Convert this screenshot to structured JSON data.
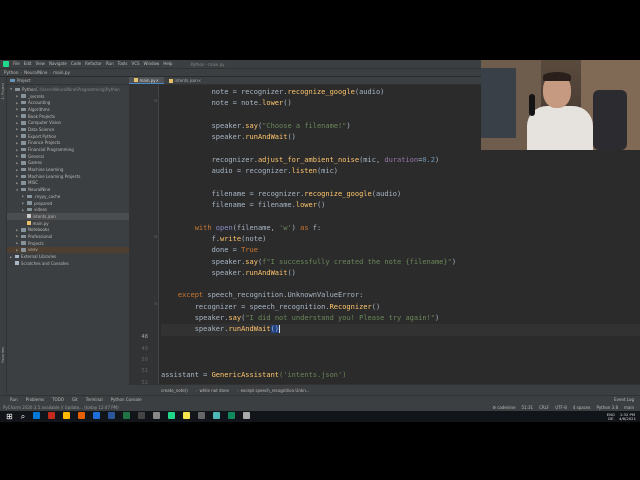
{
  "menubar": {
    "items": [
      "File",
      "Edit",
      "View",
      "Navigate",
      "Code",
      "Refactor",
      "Run",
      "Tools",
      "VCS",
      "Window",
      "Help"
    ],
    "title": "Python - main.py"
  },
  "navbar": {
    "crumbs": [
      "Python",
      "NeuralNine",
      "main.py"
    ]
  },
  "left_strip": {
    "top": "1: Project",
    "bottom": "Favorites"
  },
  "project": {
    "title": "Project",
    "tree": [
      {
        "label": "Python",
        "suffix": " C:\\Users\\NeuralNine\\Programming\\Python",
        "indent": 0,
        "kind": "folder",
        "open": true,
        "state": ""
      },
      {
        "label": "_secrets",
        "indent": 1,
        "kind": "folder",
        "open": false,
        "state": ""
      },
      {
        "label": "Accounting",
        "indent": 1,
        "kind": "folder",
        "open": false,
        "state": ""
      },
      {
        "label": "Algorithms",
        "indent": 1,
        "kind": "folder",
        "open": false,
        "state": ""
      },
      {
        "label": "Book Projects",
        "indent": 1,
        "kind": "folder",
        "open": false,
        "state": ""
      },
      {
        "label": "Computer Vision",
        "indent": 1,
        "kind": "folder",
        "open": false,
        "state": ""
      },
      {
        "label": "Data Science",
        "indent": 1,
        "kind": "folder",
        "open": false,
        "state": ""
      },
      {
        "label": "Export Python",
        "indent": 1,
        "kind": "folder",
        "open": false,
        "state": ""
      },
      {
        "label": "Finance Projects",
        "indent": 1,
        "kind": "folder",
        "open": false,
        "state": ""
      },
      {
        "label": "Financial Programming",
        "indent": 1,
        "kind": "folder",
        "open": false,
        "state": ""
      },
      {
        "label": "General",
        "indent": 1,
        "kind": "folder",
        "open": false,
        "state": ""
      },
      {
        "label": "Games",
        "indent": 1,
        "kind": "folder",
        "open": false,
        "state": ""
      },
      {
        "label": "Machine Learning",
        "indent": 1,
        "kind": "folder",
        "open": false,
        "state": ""
      },
      {
        "label": "Machine Learning Projects",
        "indent": 1,
        "kind": "folder",
        "open": false,
        "state": ""
      },
      {
        "label": "MISC",
        "indent": 1,
        "kind": "folder",
        "open": false,
        "state": ""
      },
      {
        "label": "NeuralNine",
        "indent": 1,
        "kind": "folder",
        "open": true,
        "state": ""
      },
      {
        "label": ".mypy_cache",
        "indent": 2,
        "kind": "folder",
        "open": false,
        "state": ""
      },
      {
        "label": "prepared",
        "indent": 2,
        "kind": "folder",
        "open": false,
        "state": ""
      },
      {
        "label": "videos",
        "indent": 2,
        "kind": "folder",
        "open": false,
        "state": ""
      },
      {
        "label": "intents.json",
        "indent": 2,
        "kind": "json",
        "open": null,
        "state": "selected"
      },
      {
        "label": "main.py",
        "indent": 2,
        "kind": "py",
        "open": null,
        "state": ""
      },
      {
        "label": "Notebooks",
        "indent": 1,
        "kind": "folder",
        "open": false,
        "state": ""
      },
      {
        "label": "Professional",
        "indent": 1,
        "kind": "folder",
        "open": false,
        "state": ""
      },
      {
        "label": "Projects",
        "indent": 1,
        "kind": "folder",
        "open": false,
        "state": ""
      },
      {
        "label": "venv",
        "indent": 1,
        "kind": "folder",
        "open": false,
        "state": "hl"
      },
      {
        "label": "External Libraries",
        "indent": 0,
        "kind": "lib",
        "open": false,
        "state": ""
      },
      {
        "label": "Scratches and Consoles",
        "indent": 0,
        "kind": "lib",
        "open": null,
        "state": ""
      }
    ]
  },
  "editor": {
    "tabs": [
      {
        "label": "main.py",
        "active": true
      },
      {
        "label": "intents.json",
        "active": false
      }
    ],
    "line_numbers": [
      "",
      "",
      "",
      "",
      "",
      "",
      "",
      "",
      "",
      "",
      "",
      "",
      "",
      "",
      "",
      "",
      "",
      "",
      "",
      "",
      "",
      "48",
      "49",
      "50",
      "51",
      "52",
      "",
      "",
      "55"
    ],
    "current_line": 51,
    "lines": [
      {
        "indent": 12,
        "tokens": [
          [
            "note = recognizer.",
            ""
          ],
          [
            "recognize_google",
            "fn"
          ],
          [
            "(audio)",
            ""
          ]
        ]
      },
      {
        "indent": 12,
        "tokens": [
          [
            "note = note.",
            ""
          ],
          [
            "lower",
            "fn"
          ],
          [
            "()",
            ""
          ]
        ]
      },
      {
        "indent": 0,
        "tokens": []
      },
      {
        "indent": 12,
        "tokens": [
          [
            "speaker.",
            ""
          ],
          [
            "say",
            "fn"
          ],
          [
            "(",
            ""
          ],
          [
            "\"Choose a filename!\"",
            "str"
          ],
          [
            ")",
            ""
          ]
        ]
      },
      {
        "indent": 12,
        "tokens": [
          [
            "speaker.",
            ""
          ],
          [
            "runAndWait",
            "fn"
          ],
          [
            "()",
            ""
          ]
        ]
      },
      {
        "indent": 0,
        "tokens": []
      },
      {
        "indent": 12,
        "tokens": [
          [
            "recognizer.",
            ""
          ],
          [
            "adjust_for_ambient_noise",
            "fn"
          ],
          [
            "(mic, ",
            ""
          ],
          [
            "duration",
            "mem"
          ],
          [
            "=",
            ""
          ],
          [
            "0.2",
            "num"
          ],
          [
            ")",
            ""
          ]
        ]
      },
      {
        "indent": 12,
        "tokens": [
          [
            "audio = recognizer.",
            ""
          ],
          [
            "listen",
            "fn"
          ],
          [
            "(mic)",
            ""
          ]
        ]
      },
      {
        "indent": 0,
        "tokens": []
      },
      {
        "indent": 12,
        "tokens": [
          [
            "filename = recognizer.",
            ""
          ],
          [
            "recognize_google",
            "fn"
          ],
          [
            "(audio)",
            ""
          ]
        ]
      },
      {
        "indent": 12,
        "tokens": [
          [
            "filename = filename.",
            ""
          ],
          [
            "lower",
            "fn"
          ],
          [
            "()",
            ""
          ]
        ]
      },
      {
        "indent": 0,
        "tokens": []
      },
      {
        "indent": 8,
        "tokens": [
          [
            "with ",
            "kw"
          ],
          [
            "open",
            "bi"
          ],
          [
            "(filename, ",
            ""
          ],
          [
            "'w'",
            "str"
          ],
          [
            ") ",
            ""
          ],
          [
            "as ",
            "kw"
          ],
          [
            "f:",
            ""
          ]
        ]
      },
      {
        "indent": 12,
        "tokens": [
          [
            "f.",
            ""
          ],
          [
            "write",
            "fn"
          ],
          [
            "(note)",
            ""
          ]
        ]
      },
      {
        "indent": 12,
        "tokens": [
          [
            "done = ",
            ""
          ],
          [
            "True",
            "kw"
          ]
        ]
      },
      {
        "indent": 12,
        "tokens": [
          [
            "speaker.",
            ""
          ],
          [
            "say",
            "fn"
          ],
          [
            "(",
            ""
          ],
          [
            "f\"I successfully created the note {filename}\"",
            "str"
          ],
          [
            ")",
            ""
          ]
        ]
      },
      {
        "indent": 12,
        "tokens": [
          [
            "speaker.",
            ""
          ],
          [
            "runAndWait",
            "fn"
          ],
          [
            "()",
            ""
          ]
        ]
      },
      {
        "indent": 0,
        "tokens": []
      },
      {
        "indent": 4,
        "tokens": [
          [
            "except ",
            "kw"
          ],
          [
            "speech_recognition.UnknownValueError:",
            ""
          ]
        ]
      },
      {
        "indent": 8,
        "tokens": [
          [
            "recognizer = speech_recognition.",
            ""
          ],
          [
            "Recognizer",
            "fn"
          ],
          [
            "()",
            ""
          ]
        ]
      },
      {
        "indent": 8,
        "tokens": [
          [
            "speaker.",
            ""
          ],
          [
            "say",
            "fn"
          ],
          [
            "(",
            ""
          ],
          [
            "\"I did not understand you! Please try again!\"",
            "str"
          ],
          [
            ")",
            ""
          ]
        ]
      },
      {
        "indent": 8,
        "tokens": [
          [
            "speaker.",
            ""
          ],
          [
            "runAndWait",
            "fn"
          ],
          [
            "()",
            "sel"
          ]
        ]
      },
      {
        "indent": 0,
        "tokens": []
      },
      {
        "indent": 0,
        "tokens": []
      },
      {
        "indent": 0,
        "tokens": []
      },
      {
        "indent": 0,
        "tokens": [
          [
            "assistant = ",
            ""
          ],
          [
            "GenericAssistant",
            "fn"
          ],
          [
            "('intents.json')",
            "str"
          ]
        ]
      }
    ]
  },
  "breadcrumb_bar": [
    "create_note()",
    "while not done",
    "except speech_recognition.Unkn..."
  ],
  "tool_windows": {
    "left": [
      "Run",
      "Problems",
      "TODO",
      "Git",
      "Terminal",
      "Python Console"
    ],
    "right": "Event Log"
  },
  "status": {
    "left": "PyCharm 2020.3.5 available // Update... (today 12:47 PM)",
    "right": [
      "⚙ codenine",
      "51:31",
      "CRLF",
      "UTF-8",
      "4 spaces",
      "Python 3.8",
      "main"
    ]
  },
  "taskbar": {
    "time": "1:32 PM",
    "date": "4/6/2021",
    "lang": "ENG",
    "region": "DE",
    "icon_colors": [
      "#0078d7",
      "#c42b1c",
      "#ffb900",
      "#e66000",
      "#1e6fd9",
      "#2b579a",
      "#217346",
      "#444",
      "#888",
      "#21d789",
      "#f4e64c",
      "#666",
      "#4eb9b9",
      "#0f8a5f",
      "#aaaaaa"
    ]
  },
  "colors": {
    "editor_bg": "#2b2b2b",
    "panel_bg": "#3c3f41",
    "keyword": "#cc7832",
    "function": "#ffc66d",
    "string": "#6a8759",
    "number": "#6897bb"
  }
}
